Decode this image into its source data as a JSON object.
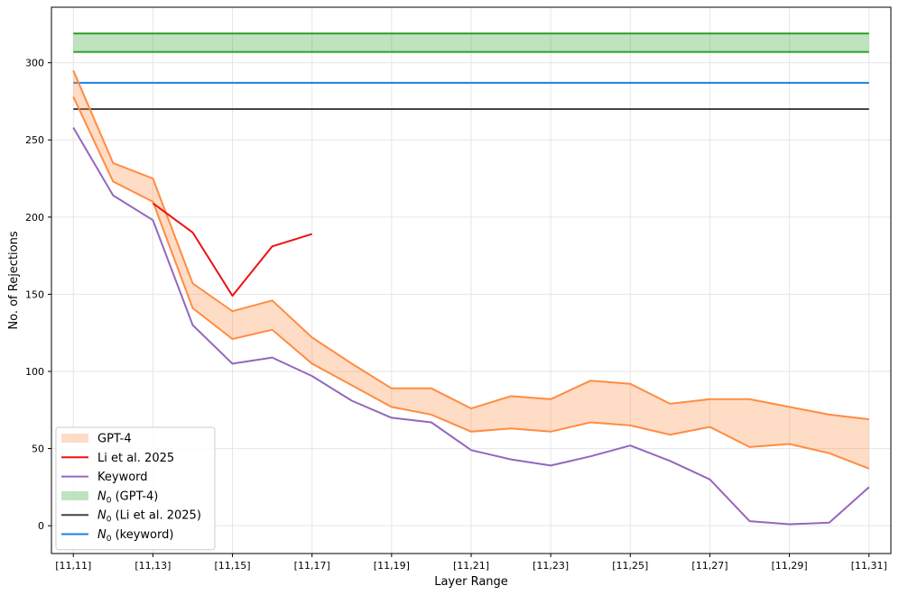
{
  "chart_data": {
    "type": "line",
    "title": "",
    "xlabel": "Layer Range",
    "ylabel": "No. of Rejections",
    "x_ticks": [
      "[11,11]",
      "[11,13]",
      "[11,15]",
      "[11,17]",
      "[11,19]",
      "[11,21]",
      "[11,23]",
      "[11,25]",
      "[11,27]",
      "[11,29]",
      "[11,31]"
    ],
    "layer_end": [
      11,
      12,
      13,
      14,
      15,
      16,
      17,
      18,
      19,
      20,
      21,
      22,
      23,
      24,
      25,
      26,
      27,
      28,
      29,
      30,
      31
    ],
    "xlim": [
      10.45,
      31.55
    ],
    "ylim": [
      -18,
      336
    ],
    "y_ticks": [
      0,
      50,
      100,
      150,
      200,
      250,
      300
    ],
    "grid": true,
    "legend_position": "lower-left",
    "series": [
      {
        "name": "GPT-4",
        "kind": "band",
        "color": "#ff8c42",
        "upper": [
          295,
          235,
          225,
          157,
          139,
          146,
          122,
          105,
          89,
          89,
          76,
          84,
          82,
          94,
          92,
          79,
          82,
          82,
          77,
          72,
          69
        ],
        "lower": [
          278,
          223,
          210,
          141,
          121,
          127,
          105,
          91,
          77,
          72,
          61,
          63,
          61,
          67,
          65,
          59,
          64,
          51,
          53,
          47,
          37
        ]
      },
      {
        "name": "Li et al. 2025",
        "kind": "line",
        "color": "#ee1111",
        "x": [
          13,
          14,
          15,
          16,
          17
        ],
        "values": [
          209,
          190,
          149,
          181,
          189
        ]
      },
      {
        "name": "Keyword",
        "kind": "line",
        "color": "#9467bd",
        "values": [
          258,
          214,
          198,
          130,
          105,
          109,
          97,
          81,
          70,
          67,
          49,
          43,
          39,
          45,
          52,
          42,
          30,
          3,
          1,
          2,
          25
        ]
      },
      {
        "name": "N0 (GPT-4)",
        "legend_label": {
          "base": "N",
          "sub": "0",
          "rest": " (GPT-4)"
        },
        "kind": "hband",
        "color": "#2ca02c",
        "low": 307,
        "high": 319
      },
      {
        "name": "N0 (Li et al. 2025)",
        "legend_label": {
          "base": "N",
          "sub": "0",
          "rest": " (Li et al. 2025)"
        },
        "kind": "hline",
        "color": "#444444",
        "value": 270
      },
      {
        "name": "N0 (keyword)",
        "legend_label": {
          "base": "N",
          "sub": "0",
          "rest": " (keyword)"
        },
        "kind": "hline",
        "color": "#1a80e5",
        "value": 287
      }
    ]
  }
}
